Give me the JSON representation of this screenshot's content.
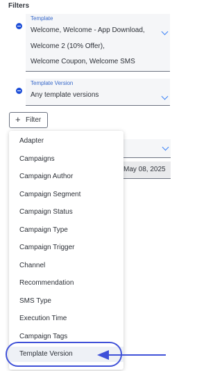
{
  "filters_title": "Filters",
  "template_field": {
    "label": "Template",
    "lines": [
      "Welcome, Welcome - App Download,",
      "Welcome 2 (10% Offer),",
      "Welcome Coupon, Welcome SMS"
    ]
  },
  "template_version_field": {
    "label": "Template Version",
    "value": "Any template versions"
  },
  "filter_button": {
    "label": "Filter"
  },
  "background_date": "May 08, 2025",
  "menu": {
    "items": [
      "Adapter",
      "Campaigns",
      "Campaign Author",
      "Campaign Segment",
      "Campaign Status",
      "Campaign Type",
      "Campaign Trigger",
      "Channel",
      "Recommendation",
      "SMS Type",
      "Execution Time",
      "Campaign Tags",
      "Template Version"
    ],
    "highlighted_item": "Template Version"
  },
  "colors": {
    "accent_blue": "#1d4ed8",
    "annotation_arrow": "#3f51d8",
    "label_blue": "#3567c9"
  }
}
